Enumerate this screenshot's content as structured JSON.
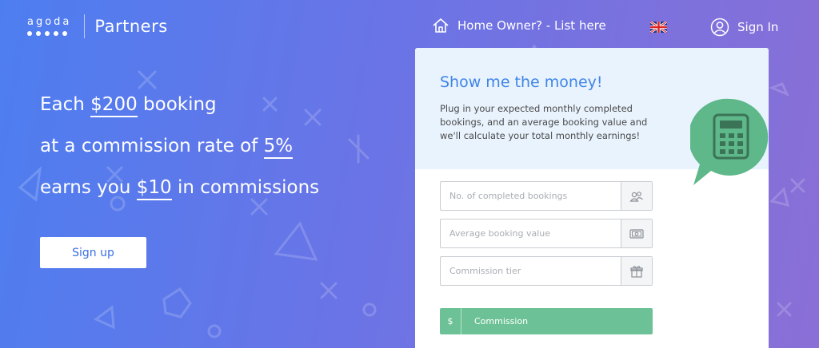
{
  "brand": {
    "logo_text": "agoda",
    "product": "Partners"
  },
  "nav": {
    "home_owner": "Home Owner? - List here",
    "language_flag": "uk-flag-icon",
    "sign_in": "Sign In"
  },
  "hero": {
    "line1_pre": "Each ",
    "line1_amount": "$200",
    "line1_post": " booking",
    "line2_pre": "at a commission rate of ",
    "line2_rate": "5%",
    "line3_pre": "earns you ",
    "line3_amount": "$10",
    "line3_post": " in commissions",
    "signup_label": "Sign up"
  },
  "calculator": {
    "title": "Show me the money!",
    "description": "Plug in your expected monthly completed bookings, and an average booking value and we'll calculate your total monthly earnings!",
    "fields": [
      {
        "placeholder": "No. of completed bookings",
        "icon": "people-icon"
      },
      {
        "placeholder": "Average booking value",
        "icon": "money-icon"
      },
      {
        "placeholder": "Commission tier",
        "icon": "gift-icon"
      }
    ],
    "result_currency": "$",
    "result_label": "Commission"
  },
  "colors": {
    "gradient_start": "#4d7ef0",
    "gradient_end": "#8a6fd6",
    "title_blue": "#3f85e8",
    "green": "#6cc296",
    "badge_green": "#5eb88a"
  }
}
